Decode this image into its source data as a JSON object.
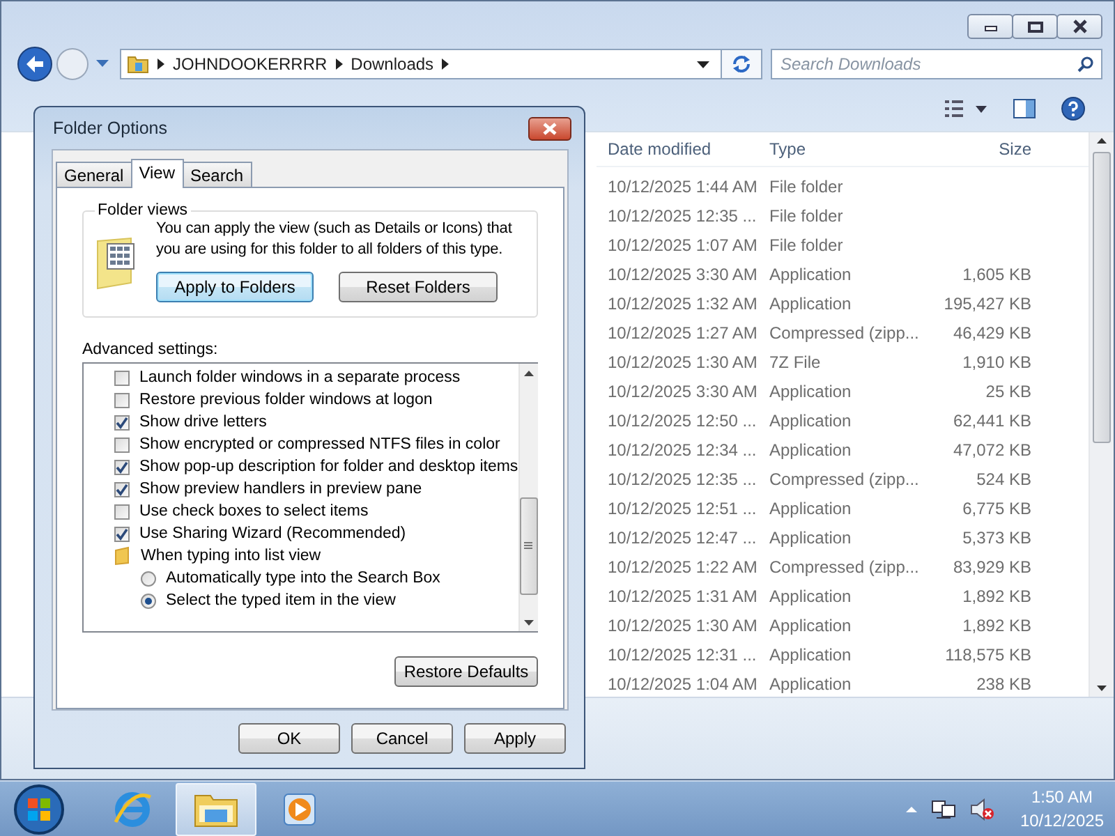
{
  "explorer": {
    "address": {
      "path": [
        "JOHNDOOKERRRR",
        "Downloads"
      ]
    },
    "search": {
      "placeholder": "Search Downloads"
    },
    "file_list": {
      "columns": [
        "Date modified",
        "Type",
        "Size"
      ],
      "rows": [
        {
          "date": "10/12/2025 1:44 AM",
          "type": "File folder",
          "size": ""
        },
        {
          "date": "10/12/2025 12:35 ...",
          "type": "File folder",
          "size": ""
        },
        {
          "date": "10/12/2025 1:07 AM",
          "type": "File folder",
          "size": ""
        },
        {
          "date": "10/12/2025 3:30 AM",
          "type": "Application",
          "size": "1,605 KB"
        },
        {
          "date": "10/12/2025 1:32 AM",
          "type": "Application",
          "size": "195,427 KB"
        },
        {
          "date": "10/12/2025 1:27 AM",
          "type": "Compressed (zipp...",
          "size": "46,429 KB"
        },
        {
          "date": "10/12/2025 1:30 AM",
          "type": "7Z File",
          "size": "1,910 KB"
        },
        {
          "date": "10/12/2025 3:30 AM",
          "type": "Application",
          "size": "25 KB"
        },
        {
          "date": "10/12/2025 12:50 ...",
          "type": "Application",
          "size": "62,441 KB"
        },
        {
          "date": "10/12/2025 12:34 ...",
          "type": "Application",
          "size": "47,072 KB"
        },
        {
          "date": "10/12/2025 12:35 ...",
          "type": "Compressed (zipp...",
          "size": "524 KB"
        },
        {
          "date": "10/12/2025 12:51 ...",
          "type": "Application",
          "size": "6,775 KB"
        },
        {
          "date": "10/12/2025 12:47 ...",
          "type": "Application",
          "size": "5,373 KB"
        },
        {
          "date": "10/12/2025 1:22 AM",
          "type": "Compressed (zipp...",
          "size": "83,929 KB"
        },
        {
          "date": "10/12/2025 1:31 AM",
          "type": "Application",
          "size": "1,892 KB"
        },
        {
          "date": "10/12/2025 1:30 AM",
          "type": "Application",
          "size": "1,892 KB"
        },
        {
          "date": "10/12/2025 12:31 ...",
          "type": "Application",
          "size": "118,575 KB"
        },
        {
          "date": "10/12/2025 1:04 AM",
          "type": "Application",
          "size": "238 KB"
        }
      ]
    }
  },
  "dialog": {
    "title": "Folder Options",
    "tabs": [
      {
        "label": "General",
        "selected": false
      },
      {
        "label": "View",
        "selected": true
      },
      {
        "label": "Search",
        "selected": false
      }
    ],
    "folder_views": {
      "legend": "Folder views",
      "description": "You can apply the view (such as Details or Icons) that you are using for this folder to all folders of this type.",
      "buttons": [
        "Apply to Folders",
        "Reset Folders"
      ]
    },
    "advanced_settings": {
      "label": "Advanced settings:",
      "items": [
        {
          "kind": "checkbox",
          "label": "Launch folder windows in a separate process",
          "checked": false
        },
        {
          "kind": "checkbox",
          "label": "Restore previous folder windows at logon",
          "checked": false
        },
        {
          "kind": "checkbox",
          "label": "Show drive letters",
          "checked": true
        },
        {
          "kind": "checkbox",
          "label": "Show encrypted or compressed NTFS files in color",
          "checked": false
        },
        {
          "kind": "checkbox",
          "label": "Show pop-up description for folder and desktop items",
          "checked": true
        },
        {
          "kind": "checkbox",
          "label": "Show preview handlers in preview pane",
          "checked": true
        },
        {
          "kind": "checkbox",
          "label": "Use check boxes to select items",
          "checked": false
        },
        {
          "kind": "checkbox",
          "label": "Use Sharing Wizard (Recommended)",
          "checked": true
        },
        {
          "kind": "folder",
          "label": "When typing into list view",
          "children": [
            {
              "kind": "radio",
              "label": "Automatically type into the Search Box",
              "selected": false
            },
            {
              "kind": "radio",
              "label": "Select the typed item in the view",
              "selected": true
            }
          ]
        }
      ]
    },
    "restore_button": "Restore Defaults",
    "buttons": [
      "OK",
      "Cancel",
      "Apply"
    ]
  },
  "taskbar": {
    "apps": [
      {
        "kind": "browser",
        "active": false
      },
      {
        "kind": "folder",
        "active": true
      },
      {
        "kind": "media",
        "active": false
      }
    ],
    "clock": {
      "time": "1:50 AM",
      "date": "10/12/2025"
    }
  }
}
